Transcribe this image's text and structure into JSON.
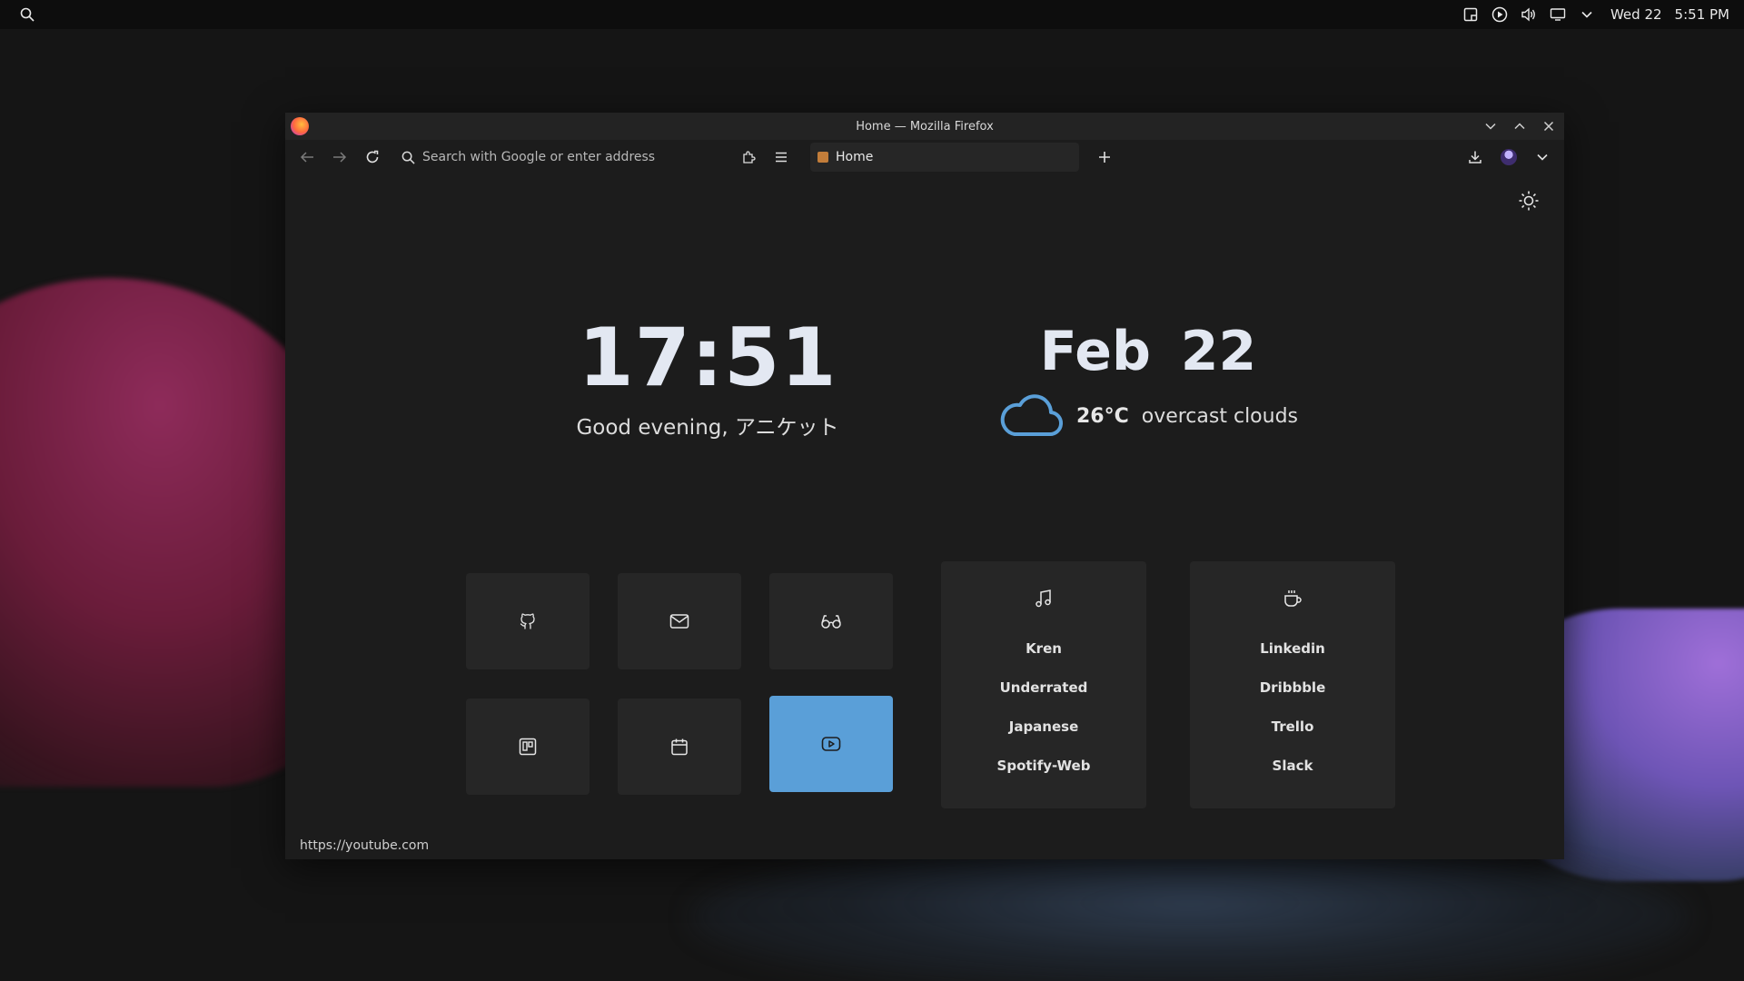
{
  "topbar": {
    "date": "Wed 22",
    "time": "5:51 PM"
  },
  "window": {
    "title": "Home — Mozilla Firefox"
  },
  "navbar": {
    "search_placeholder": "Search with Google or enter address",
    "tab_label": "Home"
  },
  "page": {
    "clock": "17:51",
    "greeting": "Good evening, アニケット",
    "date": "Feb 22",
    "temperature": "26°C",
    "condition": "overcast clouds",
    "tiles": [
      {
        "icon": "github-icon"
      },
      {
        "icon": "mail-icon"
      },
      {
        "icon": "glasses-icon"
      },
      {
        "icon": "trello-icon"
      },
      {
        "icon": "calendar-icon"
      },
      {
        "icon": "youtube-icon",
        "active": true
      }
    ],
    "music_links": [
      "Kren",
      "Underrated",
      "Japanese",
      "Spotify-Web"
    ],
    "work_links": [
      "Linkedin",
      "Dribbble",
      "Trello",
      "Slack"
    ],
    "status_url": "https://youtube.com"
  },
  "colors": {
    "accent": "#5a9fd8",
    "tile_bg": "#262626",
    "window_bg": "#1c1c1c"
  }
}
